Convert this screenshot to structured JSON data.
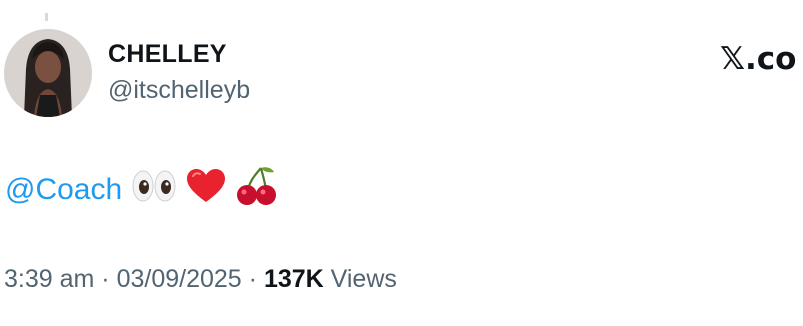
{
  "author": {
    "display_name": "CHELLEY",
    "handle": "@itschelleyb"
  },
  "brand": {
    "logo_text": "𝕏.co"
  },
  "tweet": {
    "mention": "@Coach",
    "emojis": [
      "eyes-emoji",
      "red-heart-emoji",
      "cherries-emoji"
    ]
  },
  "meta": {
    "time": "3:39 am",
    "separator": "·",
    "date": "03/09/2025",
    "views_count": "137K",
    "views_label": "Views"
  },
  "colors": {
    "mention": "#1d9bf0",
    "secondary_text": "#536471",
    "primary_text": "#0f1419"
  }
}
